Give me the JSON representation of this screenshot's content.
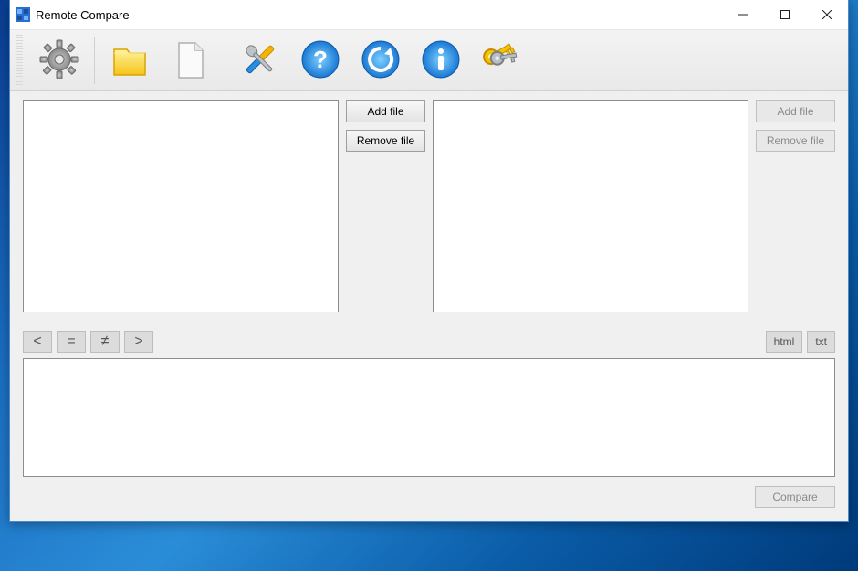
{
  "titlebar": {
    "title": "Remote Compare"
  },
  "toolbar": {
    "icons": {
      "settings": "gear-icon",
      "folder": "folder-icon",
      "file": "file-icon",
      "tools": "tools-icon",
      "help": "help-icon",
      "refresh": "refresh-icon",
      "info": "info-icon",
      "keys": "keys-icon"
    }
  },
  "panels": {
    "left": {
      "add_label": "Add file",
      "remove_label": "Remove file"
    },
    "right": {
      "add_label": "Add file",
      "remove_label": "Remove file"
    }
  },
  "filters": {
    "lt": "<",
    "eq": "=",
    "ne": "≠",
    "gt": ">",
    "html": "html",
    "txt": "txt"
  },
  "footer": {
    "compare_label": "Compare"
  }
}
